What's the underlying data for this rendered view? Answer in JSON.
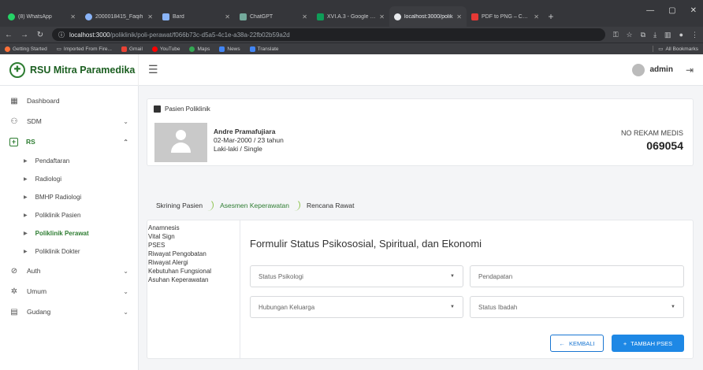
{
  "browser": {
    "tabs": [
      {
        "title": "(8) WhatsApp",
        "color": "#25d366"
      },
      {
        "title": "2000018415_Faqih",
        "color": "#8ab4f8"
      },
      {
        "title": "Bard",
        "color": "#8ab4f8"
      },
      {
        "title": "ChatGPT",
        "color": "#74aa9c"
      },
      {
        "title": "XVI.A.3 - Google Spr",
        "color": "#0f9d58"
      },
      {
        "title": "localhost:3000/polik",
        "color": "#e8eaed"
      },
      {
        "title": "PDF to PNG – Conve",
        "color": "#e53935"
      }
    ],
    "url_host": "localhost:3000",
    "url_path": "/poliklinik/poli-perawat/f066b73c-d5a5-4c1e-a38a-22fb02b59a2d",
    "bookmarks": [
      "Getting Started",
      "Imported From Fire...",
      "Gmail",
      "YouTube",
      "Maps",
      "News",
      "Translate"
    ],
    "bookmarks_right": "All Bookmarks"
  },
  "app": {
    "brand": "RSU Mitra Paramedika",
    "user": "admin"
  },
  "sidebar": {
    "items": [
      {
        "label": "Dashboard",
        "icon": "dashboard-icon",
        "glyph": "▦"
      },
      {
        "label": "SDM",
        "icon": "people-icon",
        "glyph": "⚇"
      },
      {
        "label": "RS",
        "icon": "plus-box-icon",
        "glyph": "+"
      }
    ],
    "rs_children": [
      "Pendaftaran",
      "Radiologi",
      "BMHP Radiologi",
      "Poliklinik Pasien",
      "Poliklinik Perawat",
      "Poliklinik Dokter"
    ],
    "bottom_items": [
      {
        "label": "Auth",
        "icon": "auth-icon",
        "glyph": "⊘"
      },
      {
        "label": "Umum",
        "icon": "gear-icon",
        "glyph": "✲"
      },
      {
        "label": "Gudang",
        "icon": "warehouse-icon",
        "glyph": "▤"
      }
    ]
  },
  "patient": {
    "section_title": "Pasien Poliklinik",
    "name": "Andre Pramafujiara",
    "dob_age": "02-Mar-2000 / 23 tahun",
    "gender_status": "Laki-laki / Single",
    "record_label": "NO REKAM MEDIS",
    "record_number": "069054"
  },
  "steps": [
    "Skrining Pasien",
    "Asesmen Keperawatan",
    "Rencana Rawat"
  ],
  "form": {
    "nav": [
      "Anamnesis",
      "Vital Sign",
      "PSES",
      "Riwayat Pengobatan",
      "Riwayat Alergi",
      "Kebutuhan Fungsional",
      "Asuhan Keperawatan"
    ],
    "title": "Formulir Status Psikososial, Spiritual, dan Ekonomi",
    "fields": {
      "status_psikologi": "Status Psikologi",
      "pendapatan": "Pendapatan",
      "hubungan_keluarga": "Hubungan Keluarga",
      "status_ibadah": "Status Ibadah"
    },
    "back_label": "KEMBALI",
    "add_label": "TAMBAH PSES"
  }
}
